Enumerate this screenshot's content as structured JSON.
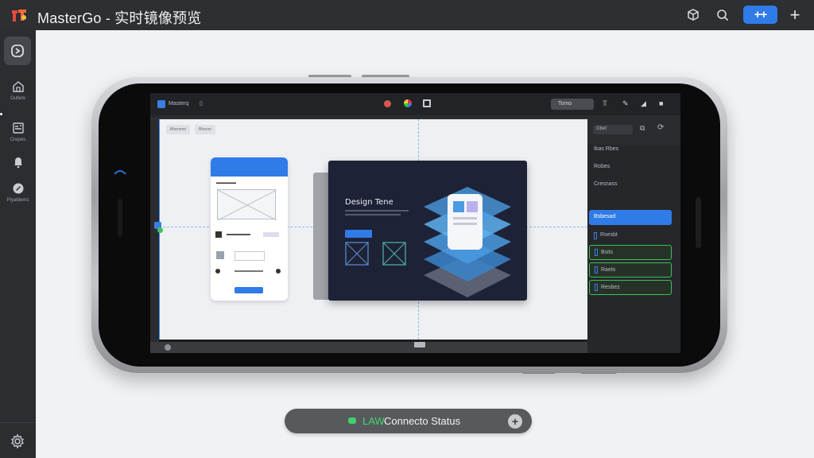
{
  "app": {
    "title": "MasterGo - 实时镜像预览",
    "share_label": "++",
    "add_label": "+"
  },
  "sidebar": {
    "items": [
      {
        "label": "Outlets",
        "icon": "home-icon"
      },
      {
        "label": "Crepes",
        "icon": "layers-icon"
      },
      {
        "label": "",
        "icon": "bell-icon"
      },
      {
        "label": "Plyablems",
        "icon": "plugin-icon"
      }
    ]
  },
  "device": {
    "toolbar": {
      "app_name": "Masterq",
      "zoom_label": "Tomo"
    },
    "artboard": {
      "chips": [
        "Bhenmm",
        "Bhenm"
      ]
    },
    "design_card": {
      "title": "Design Tene"
    },
    "right_panel": {
      "header": "Gbet",
      "items": [
        {
          "label": "Ikas Rbes",
          "state": "normal"
        },
        {
          "label": "Robes",
          "state": "normal"
        },
        {
          "label": "Cresnass",
          "state": "normal"
        },
        {
          "label": "Bsbesad",
          "state": "selected"
        },
        {
          "label": "Rsesbt",
          "state": "normal"
        },
        {
          "label": "Bsits",
          "state": "outlined"
        },
        {
          "label": "Raets",
          "state": "outlined"
        },
        {
          "label": "Resbez",
          "state": "outlined"
        }
      ]
    }
  },
  "status": {
    "indicator": "LAW",
    "label": "Connecto Status",
    "action": "+"
  },
  "colors": {
    "accent": "#2f7be8",
    "connected": "#3fd16c",
    "titlebar": "#2d2f33"
  }
}
